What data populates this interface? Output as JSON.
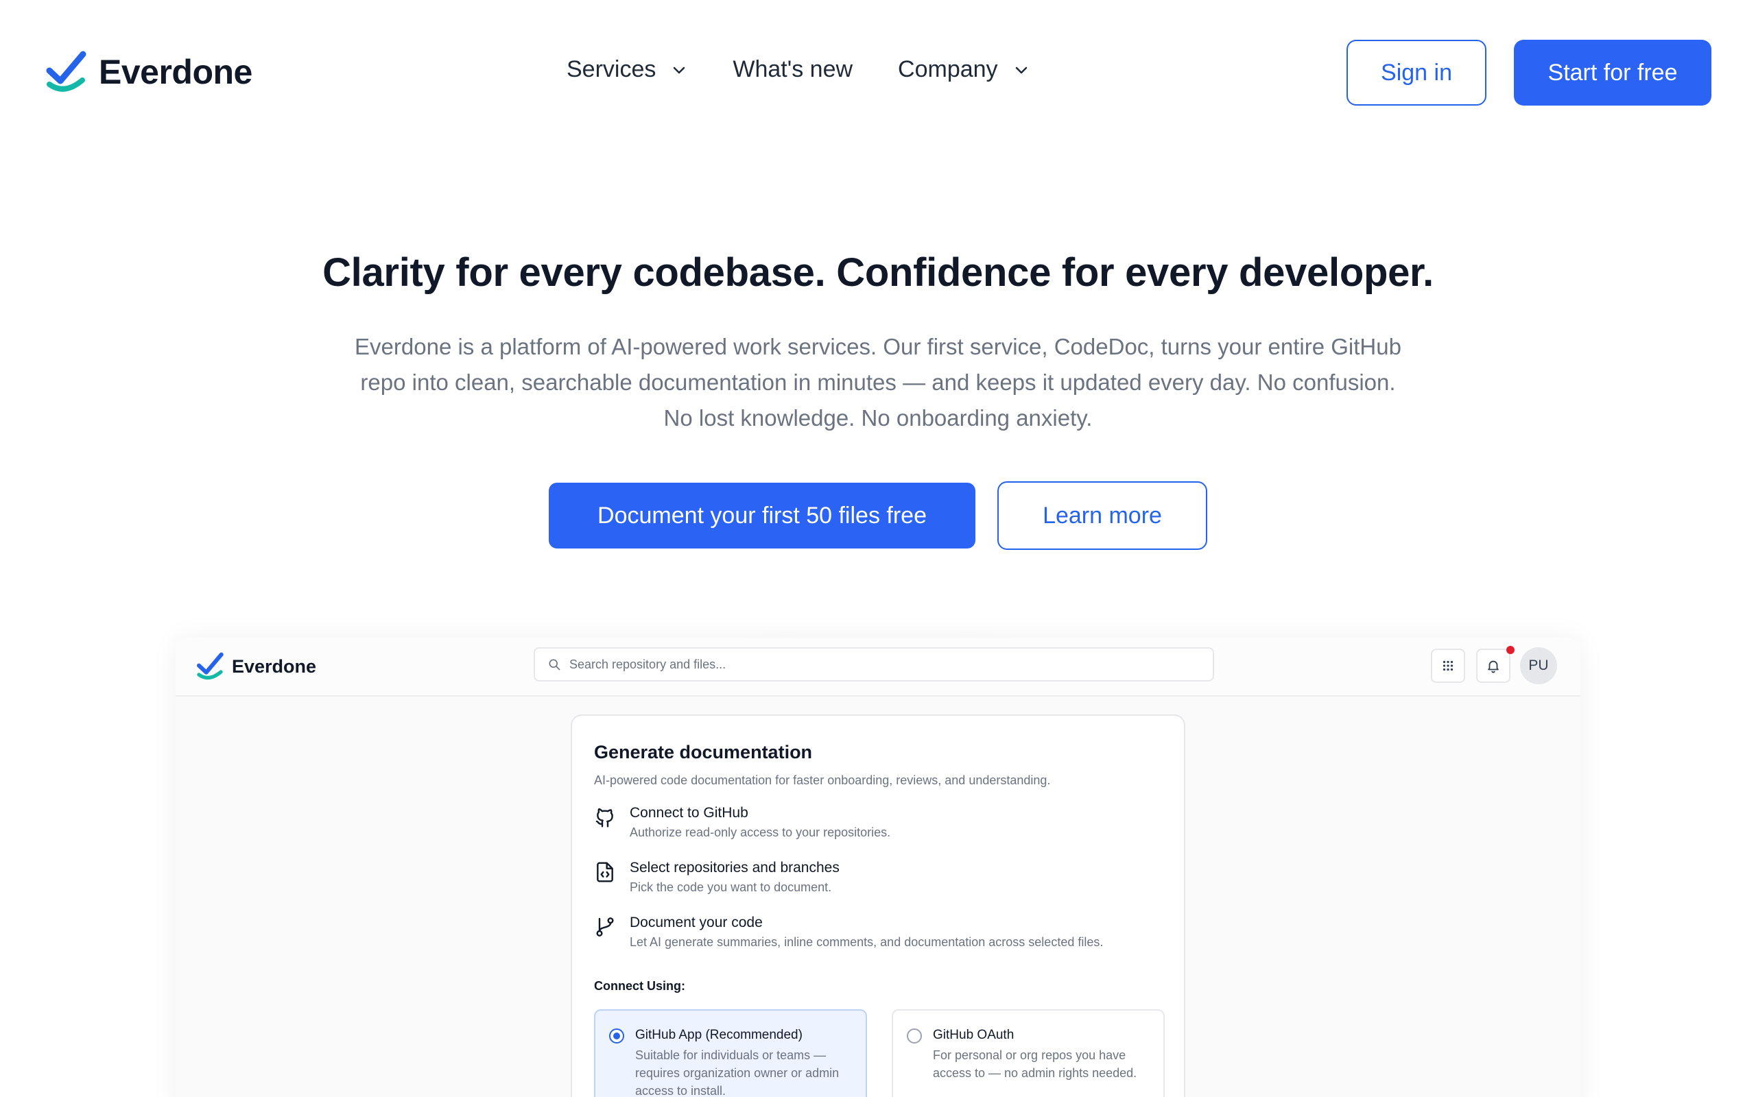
{
  "brand": {
    "name": "Everdone",
    "check_color": "#2563eb",
    "swoosh_color": "#14b8a6"
  },
  "nav": {
    "items": [
      {
        "label": "Services",
        "has_dropdown": true
      },
      {
        "label": "What's new",
        "has_dropdown": false
      },
      {
        "label": "Company",
        "has_dropdown": true
      }
    ],
    "sign_in": "Sign in",
    "start": "Start for free"
  },
  "hero": {
    "title": "Clarity for every codebase. Confidence for every developer.",
    "subtitle": "Everdone is a platform of AI-powered work services. Our first service, CodeDoc, turns your entire GitHub repo into clean, searchable documentation in minutes — and keeps it updated every day. No confusion. No lost knowledge. No onboarding anxiety.",
    "cta_primary": "Document your first 50 files free",
    "cta_secondary": "Learn more"
  },
  "preview": {
    "brand": "Everdone",
    "search_placeholder": "Search repository and files...",
    "avatar_initials": "PU",
    "card": {
      "title": "Generate documentation",
      "subtitle": "AI-powered code documentation for faster onboarding, reviews, and understanding.",
      "steps": [
        {
          "icon": "github-icon",
          "title": "Connect to GitHub",
          "desc": "Authorize read-only access to your repositories."
        },
        {
          "icon": "file-code-icon",
          "title": "Select repositories and branches",
          "desc": "Pick the code you want to document."
        },
        {
          "icon": "git-branch-icon",
          "title": "Document your code",
          "desc": "Let AI generate summaries, inline comments, and documentation across selected files."
        }
      ],
      "connect_label": "Connect Using:",
      "options": [
        {
          "title": "GitHub App (Recommended)",
          "desc": "Suitable for individuals or teams — requires organization owner or admin access to install.",
          "selected": true
        },
        {
          "title": "GitHub OAuth",
          "desc": "For personal or org repos you have access to — no admin rights needed.",
          "selected": false
        }
      ]
    }
  },
  "colors": {
    "primary": "#2b63f5",
    "text": "#111827",
    "muted": "#6b7280",
    "notification": "#e11d2e"
  }
}
